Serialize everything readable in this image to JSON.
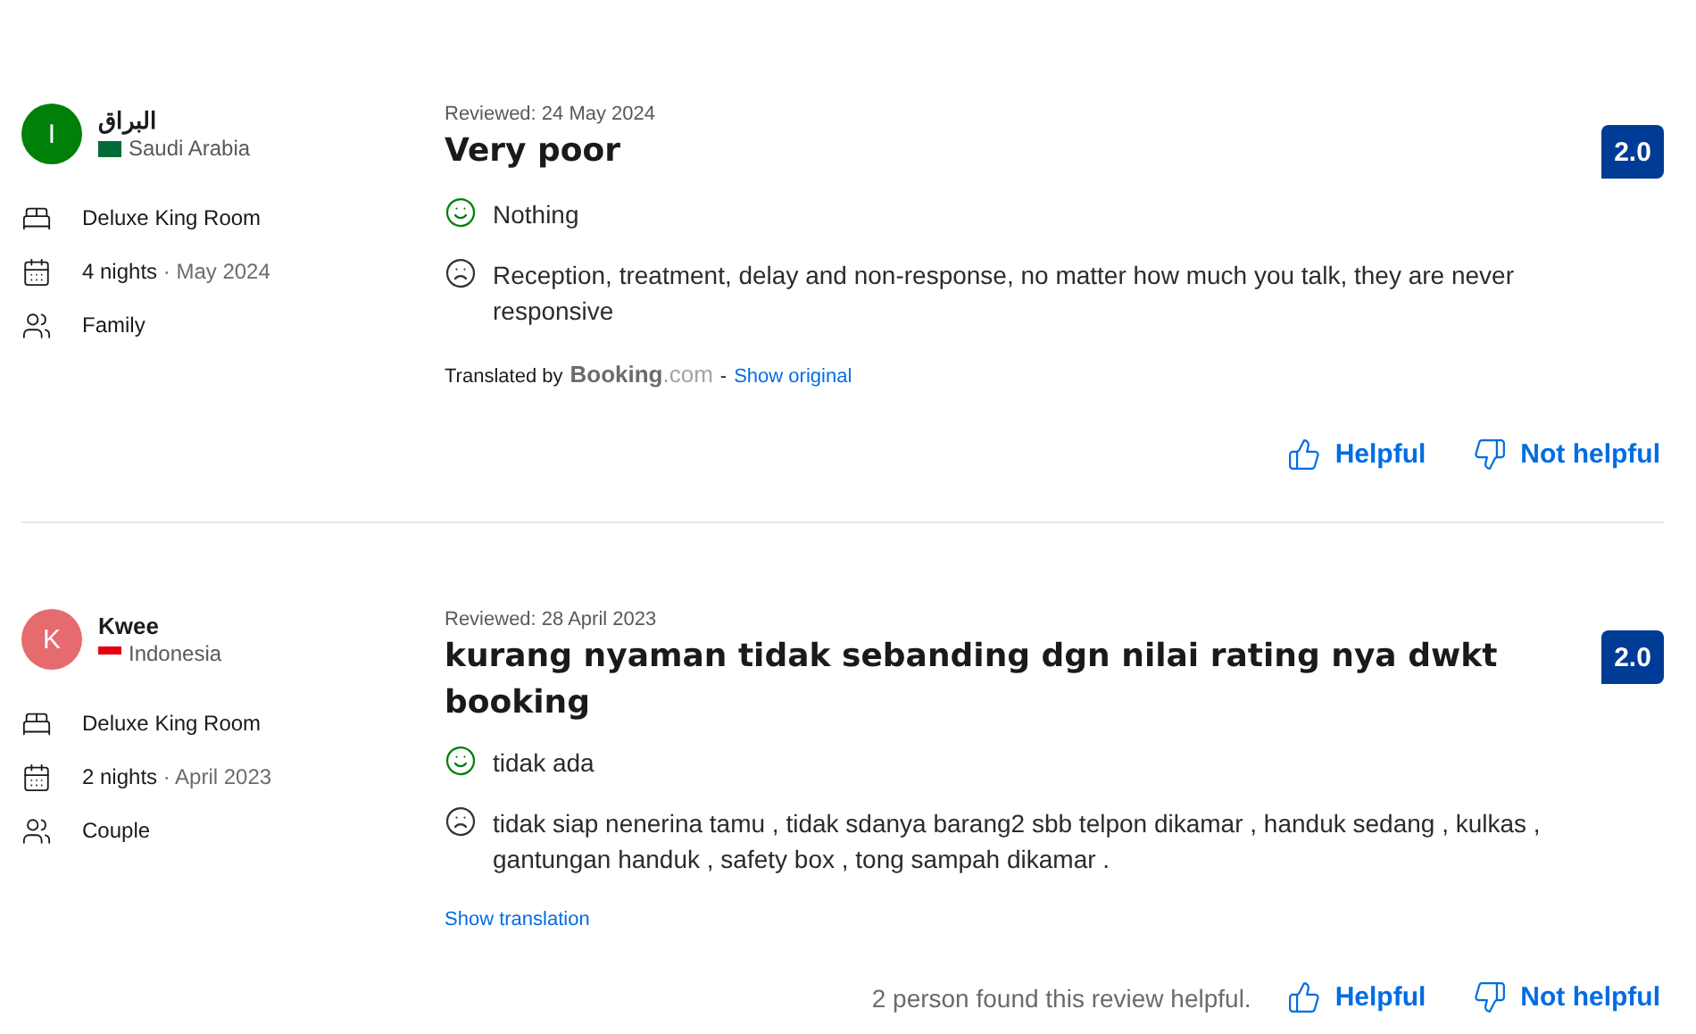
{
  "reviews": [
    {
      "reviewer": {
        "initial": "I",
        "color": "#008009",
        "name": "البراق",
        "country": "Saudi Arabia",
        "flag": [
          {
            "color": "#006c35"
          }
        ]
      },
      "stay": [
        {
          "kind": "room",
          "text": "Deluxe King Room"
        },
        {
          "kind": "nights",
          "text": "4 nights",
          "date": "· May 2024"
        },
        {
          "kind": "group",
          "text": "Family"
        }
      ],
      "reviewed": "Reviewed: 24 May 2024",
      "title": "Very poor",
      "score": "2.0",
      "liked": "Nothing",
      "disliked": "Reception, treatment, delay and non-response, no matter how much you talk, they are never responsive",
      "translation": {
        "kind": "translated",
        "label": "Translated by",
        "brand": "Booking",
        "brand_suffix": ".com",
        "separator": "-",
        "link": "Show original"
      },
      "helpful": "Helpful",
      "not_helpful": "Not helpful"
    },
    {
      "reviewer": {
        "initial": "K",
        "color": "#e56b6f",
        "name": "Kwee",
        "country": "Indonesia",
        "flag": [
          {
            "color": "#e70011"
          },
          {
            "color": "#ffffff"
          }
        ]
      },
      "stay": [
        {
          "kind": "room",
          "text": "Deluxe King Room"
        },
        {
          "kind": "nights",
          "text": "2 nights",
          "date": "· April 2023"
        },
        {
          "kind": "couple",
          "text": "Couple"
        }
      ],
      "reviewed": "Reviewed: 28 April 2023",
      "title": "kurang nyaman tidak sebanding dgn nilai rating nya dwkt booking",
      "score": "2.0",
      "liked": "tidak ada",
      "disliked": "tidak siap nenerina tamu , tidak sdanya barang2 sbb telpon dikamar , handuk sedang , kulkas , gantungan handuk , safety box , tong sampah dikamar .",
      "translation": {
        "kind": "original",
        "link": "Show translation"
      },
      "helpful_count": "2 person found this review helpful.",
      "helpful": "Helpful",
      "not_helpful": "Not helpful"
    }
  ]
}
